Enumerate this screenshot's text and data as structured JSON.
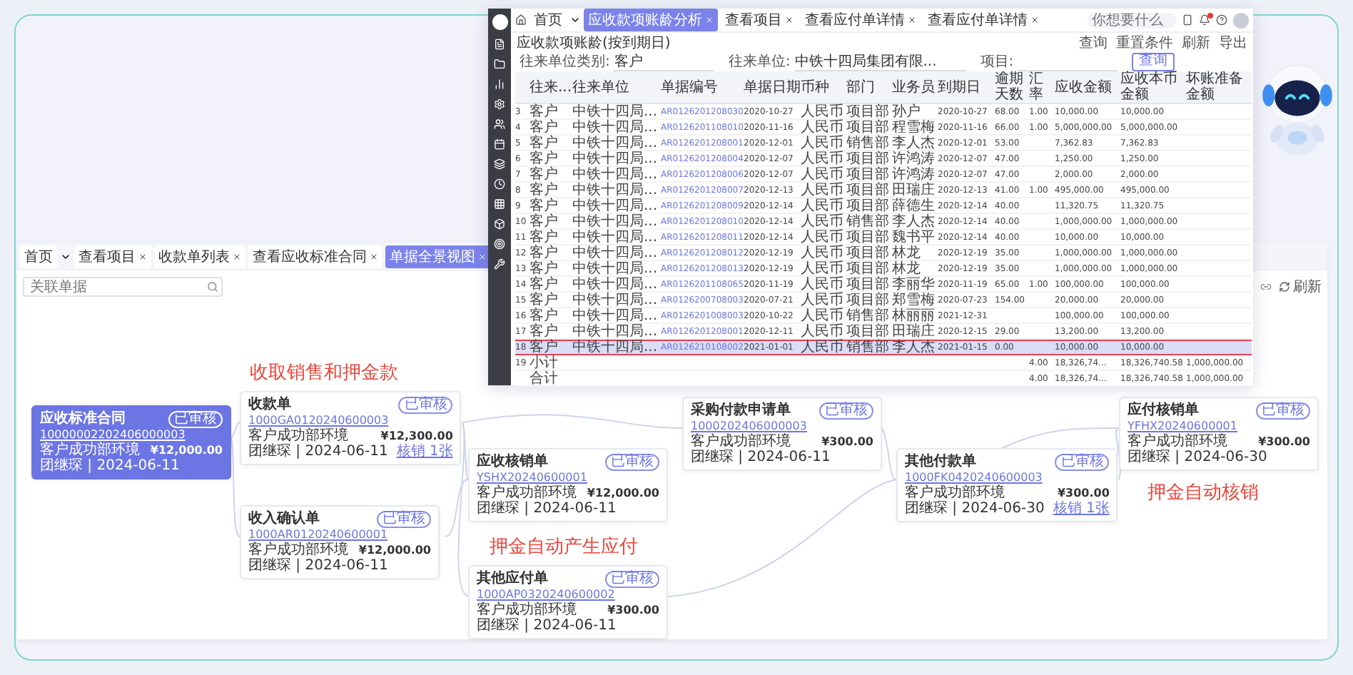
{
  "flow_view": {
    "tabs": [
      {
        "label": "首页",
        "closable": false,
        "selected": false
      },
      {
        "label": "查看项目",
        "closable": true,
        "selected": false
      },
      {
        "label": "收款单列表",
        "closable": true,
        "selected": false
      },
      {
        "label": "查看应收标准合同",
        "closable": true,
        "selected": false
      },
      {
        "label": "单据全景视图",
        "closable": true,
        "selected": true
      }
    ],
    "search": {
      "placeholder": "关联单据"
    },
    "refresh": "刷新",
    "nodes": [
      {
        "title": "应收标准合同",
        "number": "10000002202406000003",
        "org": "客户成功部环境",
        "amount": "¥12,000.00",
        "meta": "团继琛 | 2024-06-11",
        "badge": "已审核",
        "selected": true
      },
      {
        "title": "收款单",
        "number": "1000GA0120240600003",
        "org": "客户成功部环境",
        "amount": "¥12,300.00",
        "meta": "团继琛 | 2024-06-11",
        "badge": "已审核",
        "link": "核销 1张",
        "selected": false
      },
      {
        "title": "应收核销单",
        "number": "YSHX20240600001",
        "org": "客户成功部环境",
        "amount": "¥12,000.00",
        "meta": "团继琛 | 2024-06-11",
        "badge": "已审核",
        "selected": false
      },
      {
        "title": "收入确认单",
        "number": "1000AR0120240600001",
        "org": "客户成功部环境",
        "amount": "¥12,000.00",
        "meta": "团继琛 | 2024-06-11",
        "badge": "已审核",
        "selected": false
      },
      {
        "title": "其他应付单",
        "number": "1000AP0320240600002",
        "org": "客户成功部环境",
        "amount": "¥300.00",
        "meta": "团继琛 | 2024-06-11",
        "badge": "已审核",
        "selected": false
      },
      {
        "title": "采购付款申请单",
        "number": "1000202406000003",
        "org": "客户成功部环境",
        "amount": "¥300.00",
        "meta": "团继琛 | 2024-06-11",
        "badge": "已审核",
        "selected": false
      },
      {
        "title": "其他付款单",
        "number": "1000FK0420240600003",
        "org": "客户成功部环境",
        "amount": "¥300.00",
        "meta": "团继琛 | 2024-06-30",
        "badge": "已审核",
        "link": "核销 1张",
        "selected": false
      },
      {
        "title": "应付核销单",
        "number": "YFHX20240600001",
        "org": "客户成功部环境",
        "amount": "¥300.00",
        "meta": "团继琛 | 2024-06-30",
        "badge": "已审核",
        "selected": false
      }
    ],
    "annotations": [
      "收取销售和押金款",
      "押金自动产生应付",
      "押金自动核销"
    ]
  },
  "report_window": {
    "tabs": [
      {
        "label": "首页",
        "closable": false,
        "selected": false
      },
      {
        "label": "应收款项账龄分析",
        "closable": true,
        "selected": true
      },
      {
        "label": "查看项目",
        "closable": true,
        "selected": false
      },
      {
        "label": "查看应付单详情",
        "closable": true,
        "selected": false
      },
      {
        "label": "查看应付单详情",
        "closable": true,
        "selected": false
      }
    ],
    "search": {
      "placeholder": "你想要什么"
    },
    "title": "应收款项账龄(按到期日)",
    "actions": [
      "查询",
      "重置条件",
      "刷新",
      "导出"
    ],
    "filters": [
      {
        "label": "往来单位类别:",
        "value": "客户"
      },
      {
        "label": "往来单位:",
        "value": "中铁十四局集团有限..."
      },
      {
        "label": "项目:"
      }
    ],
    "query_button": "查询",
    "table": {
      "columns": [
        "",
        "往来...",
        "往来单位",
        "单据编号",
        "单据日期",
        "币种",
        "部门",
        "业务员",
        "到期日",
        "逾期天数",
        "汇率",
        "应收金额",
        "应收本币金额",
        "坏账准备金额"
      ],
      "rows": [
        {
          "cells": [
            "3",
            "客户",
            "中铁十四局...",
            "AR0126201208030",
            "2020-10-27",
            "人民币",
            "项目部",
            "孙户",
            "2020-10-27",
            "68.00",
            "1.00",
            "10,000.00",
            "10,000.00",
            ""
          ],
          "selected": false
        },
        {
          "cells": [
            "4",
            "客户",
            "中铁十四局...",
            "AR0126201108010",
            "2020-11-16",
            "人民币",
            "项目部",
            "程雪梅",
            "2020-11-16",
            "66.00",
            "1.00",
            "5,000,000.00",
            "5,000,000.00",
            ""
          ],
          "selected": false
        },
        {
          "cells": [
            "5",
            "客户",
            "中铁十四局...",
            "AR0126201208001",
            "2020-12-01",
            "人民币",
            "销售部",
            "李人杰",
            "2020-12-01",
            "53.00",
            "",
            "7,362.83",
            "7,362.83",
            ""
          ],
          "selected": false
        },
        {
          "cells": [
            "6",
            "客户",
            "中铁十四局...",
            "AR0126201208004",
            "2020-12-07",
            "人民币",
            "项目部",
            "许鸿涛",
            "2020-12-07",
            "47.00",
            "",
            "1,250.00",
            "1,250.00",
            ""
          ],
          "selected": false
        },
        {
          "cells": [
            "7",
            "客户",
            "中铁十四局...",
            "AR0126201208006",
            "2020-12-07",
            "人民币",
            "项目部",
            "许鸿涛",
            "2020-12-07",
            "47.00",
            "",
            "2,000.00",
            "2,000.00",
            ""
          ],
          "selected": false
        },
        {
          "cells": [
            "8",
            "客户",
            "中铁十四局...",
            "AR0126201208007",
            "2020-12-13",
            "人民币",
            "项目部",
            "田瑞庄",
            "2020-12-13",
            "41.00",
            "1.00",
            "495,000.00",
            "495,000.00",
            ""
          ],
          "selected": false
        },
        {
          "cells": [
            "9",
            "客户",
            "中铁十四局...",
            "AR0126201208009",
            "2020-12-14",
            "人民币",
            "项目部",
            "薛德生",
            "2020-12-14",
            "40.00",
            "",
            "11,320.75",
            "11,320.75",
            ""
          ],
          "selected": false
        },
        {
          "cells": [
            "10",
            "客户",
            "中铁十四局...",
            "AR0126201208010",
            "2020-12-14",
            "人民币",
            "销售部",
            "李人杰",
            "2020-12-14",
            "40.00",
            "",
            "1,000,000.00",
            "1,000,000.00",
            ""
          ],
          "selected": false
        },
        {
          "cells": [
            "11",
            "客户",
            "中铁十四局...",
            "AR0126201208011",
            "2020-12-14",
            "人民币",
            "项目部",
            "魏书平",
            "2020-12-14",
            "40.00",
            "",
            "10,000.00",
            "10,000.00",
            ""
          ],
          "selected": false
        },
        {
          "cells": [
            "12",
            "客户",
            "中铁十四局...",
            "AR0126201208012",
            "2020-12-19",
            "人民币",
            "项目部",
            "林龙",
            "2020-12-19",
            "35.00",
            "",
            "1,000,000.00",
            "1,000,000.00",
            ""
          ],
          "selected": false
        },
        {
          "cells": [
            "13",
            "客户",
            "中铁十四局...",
            "AR0126201208013",
            "2020-12-19",
            "人民币",
            "项目部",
            "林龙",
            "2020-12-19",
            "35.00",
            "",
            "1,000,000.00",
            "1,000,000.00",
            ""
          ],
          "selected": false
        },
        {
          "cells": [
            "14",
            "客户",
            "中铁十四局...",
            "AR0126201108065",
            "2020-11-19",
            "人民币",
            "项目部",
            "李丽华",
            "2020-11-19",
            "65.00",
            "1.00",
            "100,000.00",
            "100,000.00",
            ""
          ],
          "selected": false
        },
        {
          "cells": [
            "15",
            "客户",
            "中铁十四局...",
            "AR0126200708003",
            "2020-07-21",
            "人民币",
            "项目部",
            "郑雪梅",
            "2020-07-23",
            "154.00",
            "",
            "20,000.00",
            "20,000.00",
            ""
          ],
          "selected": false
        },
        {
          "cells": [
            "16",
            "客户",
            "中铁十四局...",
            "AR0126201008003",
            "2020-10-22",
            "人民币",
            "销售部",
            "林丽丽",
            "2021-12-31",
            "",
            "",
            "100,000.00",
            "100,000.00",
            ""
          ],
          "selected": false
        },
        {
          "cells": [
            "17",
            "客户",
            "中铁十四局...",
            "AR0126201208001",
            "2020-12-11",
            "人民币",
            "项目部",
            "田瑞庄",
            "2020-12-15",
            "29.00",
            "",
            "13,200.00",
            "13,200.00",
            ""
          ],
          "selected": false
        },
        {
          "cells": [
            "18",
            "客户",
            "中铁十四局...",
            "AR0126210108002",
            "2021-01-01",
            "人民币",
            "销售部",
            "李人杰",
            "2021-01-15",
            "0.00",
            "",
            "10,000.00",
            "10,000.00",
            ""
          ],
          "selected": true
        },
        {
          "cells": [
            "19",
            "小计",
            "",
            "",
            "",
            "",
            "",
            "",
            "",
            "",
            "4.00",
            "18,326,74...",
            "18,326,740.58",
            "1,000,000.00"
          ],
          "selected": false
        },
        {
          "cells": [
            "",
            "合计",
            "",
            "",
            "",
            "",
            "",
            "",
            "",
            "",
            "4.00",
            "18,326,74...",
            "18,326,740.58",
            "1,000,000.00"
          ],
          "selected": false
        }
      ]
    }
  }
}
